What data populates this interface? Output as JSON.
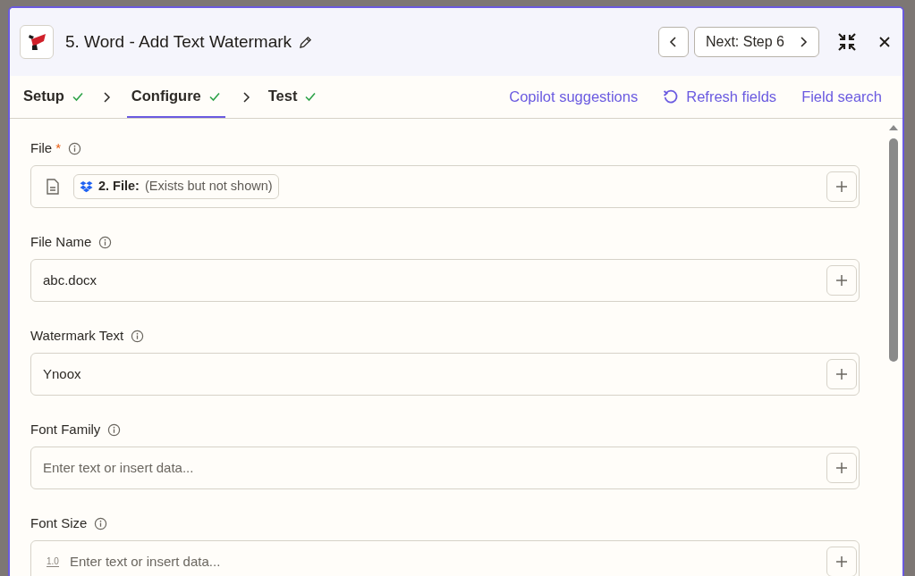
{
  "header": {
    "title": "5. Word - Add Text Watermark",
    "next_label": "Next: Step 6"
  },
  "steps": [
    {
      "label": "Setup",
      "done": true,
      "selected": false
    },
    {
      "label": "Configure",
      "done": true,
      "selected": true
    },
    {
      "label": "Test",
      "done": true,
      "selected": false
    }
  ],
  "actions": [
    {
      "label": "Copilot suggestions",
      "kind": "plain"
    },
    {
      "label": "Refresh fields",
      "kind": "refresh"
    },
    {
      "label": "Field search",
      "kind": "plain"
    }
  ],
  "fields": [
    {
      "label": "File",
      "required_mark": "*",
      "kind": "file",
      "chip_step": "2. File:",
      "chip_note": "(Exists but not shown)"
    },
    {
      "label": "File Name",
      "kind": "text",
      "value": "abc.docx"
    },
    {
      "label": "Watermark Text",
      "kind": "text",
      "value": "Ynoox"
    },
    {
      "label": "Font Family",
      "kind": "text",
      "placeholder": "Enter text or insert data..."
    },
    {
      "label": "Font Size",
      "kind": "number",
      "number_hint": "1.0",
      "placeholder": "Enter text or insert data..."
    }
  ]
}
